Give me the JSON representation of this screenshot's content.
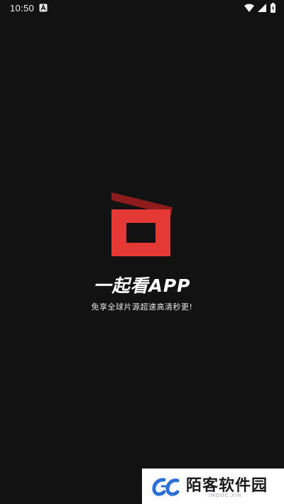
{
  "status_bar": {
    "time": "10:50",
    "icons": [
      "notification-a-icon",
      "wifi-icon",
      "signal-icon",
      "battery-icon"
    ]
  },
  "splash": {
    "logo_icon": "clapperboard-logo-icon",
    "title": "一起看APP",
    "tagline": "免享全球片源超速高清秒更!"
  },
  "watermark": {
    "name": "陌客软件园",
    "url": "IMOOC.XIN"
  },
  "colors": {
    "background": "#121212",
    "brand_red": "#e53935",
    "brand_dark_red": "#8e1c1c"
  }
}
